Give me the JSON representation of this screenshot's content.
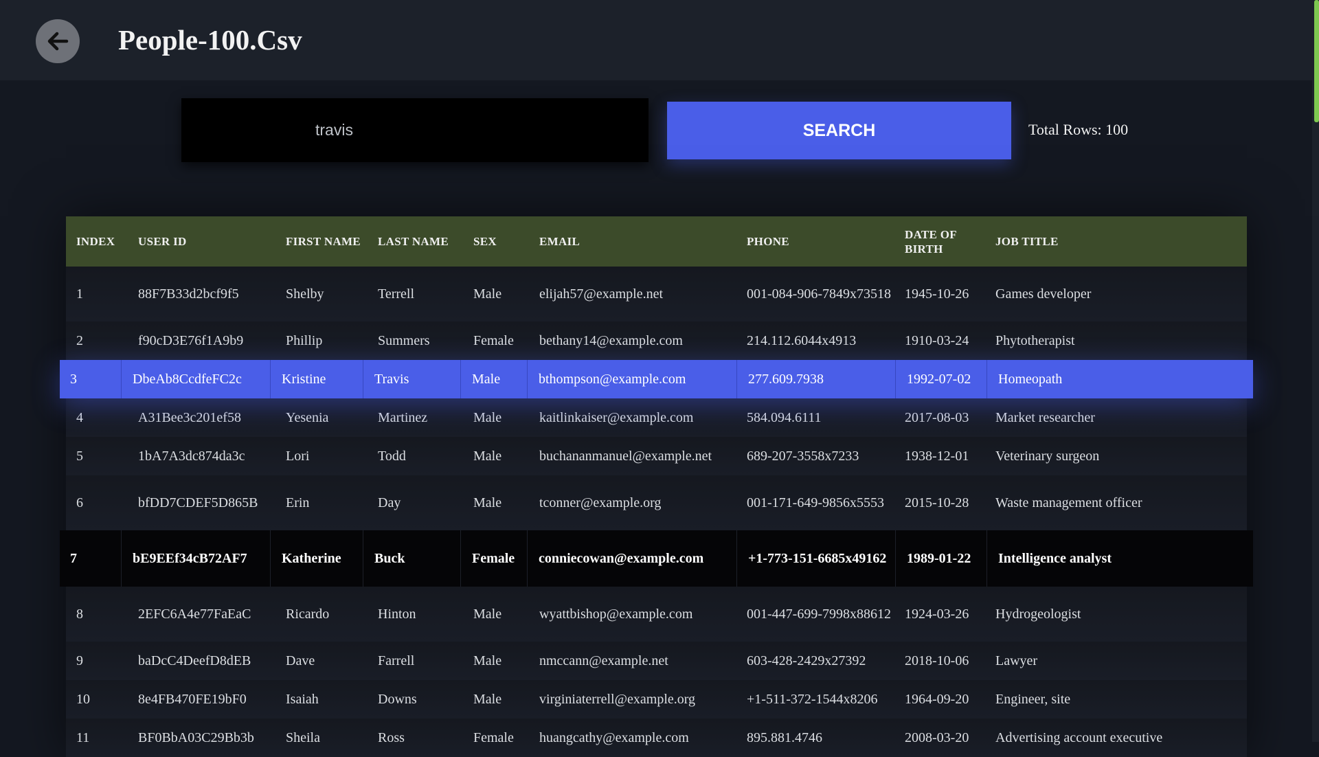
{
  "header": {
    "title": "People-100.Csv"
  },
  "search": {
    "value": "travis",
    "button_label": "SEARCH"
  },
  "total_rows_label": "Total Rows: 100",
  "table": {
    "columns": [
      "INDEX",
      "USER ID",
      "FIRST NAME",
      "LAST NAME",
      "SEX",
      "EMAIL",
      "PHONE",
      "DATE OF BIRTH",
      "JOB TITLE"
    ],
    "rows": [
      [
        "1",
        "88F7B33d2bcf9f5",
        "Shelby",
        "Terrell",
        "Male",
        "elijah57@example.net",
        "001-084-906-7849x73518",
        "1945-10-26",
        "Games developer"
      ],
      [
        "2",
        "f90cD3E76f1A9b9",
        "Phillip",
        "Summers",
        "Female",
        "bethany14@example.com",
        "214.112.6044x4913",
        "1910-03-24",
        "Phytotherapist"
      ],
      [
        "3",
        "DbeAb8CcdfeFC2c",
        "Kristine",
        "Travis",
        "Male",
        "bthompson@example.com",
        "277.609.7938",
        "1992-07-02",
        "Homeopath"
      ],
      [
        "4",
        "A31Bee3c201ef58",
        "Yesenia",
        "Martinez",
        "Male",
        "kaitlinkaiser@example.com",
        "584.094.6111",
        "2017-08-03",
        "Market researcher"
      ],
      [
        "5",
        "1bA7A3dc874da3c",
        "Lori",
        "Todd",
        "Male",
        "buchananmanuel@example.net",
        "689-207-3558x7233",
        "1938-12-01",
        "Veterinary surgeon"
      ],
      [
        "6",
        "bfDD7CDEF5D865B",
        "Erin",
        "Day",
        "Male",
        "tconner@example.org",
        "001-171-649-9856x5553",
        "2015-10-28",
        "Waste management officer"
      ],
      [
        "7",
        "bE9EEf34cB72AF7",
        "Katherine",
        "Buck",
        "Female",
        "conniecowan@example.com",
        "+1-773-151-6685x49162",
        "1989-01-22",
        "Intelligence analyst"
      ],
      [
        "8",
        "2EFC6A4e77FaEaC",
        "Ricardo",
        "Hinton",
        "Male",
        "wyattbishop@example.com",
        "001-447-699-7998x88612",
        "1924-03-26",
        "Hydrogeologist"
      ],
      [
        "9",
        "baDcC4DeefD8dEB",
        "Dave",
        "Farrell",
        "Male",
        "nmccann@example.net",
        "603-428-2429x27392",
        "2018-10-06",
        "Lawyer"
      ],
      [
        "10",
        "8e4FB470FE19bF0",
        "Isaiah",
        "Downs",
        "Male",
        "virginiaterrell@example.org",
        "+1-511-372-1544x8206",
        "1964-09-20",
        "Engineer, site"
      ],
      [
        "11",
        "BF0BbA03C29Bb3b",
        "Sheila",
        "Ross",
        "Female",
        "huangcathy@example.com",
        "895.881.4746",
        "2008-03-20",
        "Advertising account executive"
      ]
    ]
  },
  "colors": {
    "accent": "#4a5ee8",
    "header_row": "#3c4b2a",
    "background": "#141821",
    "scroll_thumb": "#7ec850"
  }
}
